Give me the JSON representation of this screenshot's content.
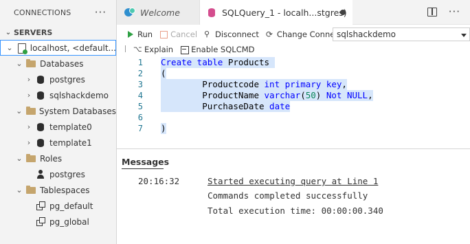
{
  "sidebar": {
    "title": "CONNECTIONS",
    "more_label": "···",
    "servers_header": "SERVERS",
    "tree": [
      {
        "label": "localhost, <default...",
        "chevron": "⌄",
        "icon": "server-icon"
      },
      {
        "label": "Databases",
        "chevron": "⌄",
        "icon": "folder-icon"
      },
      {
        "label": "postgres",
        "chevron": "›",
        "icon": "database-icon"
      },
      {
        "label": "sqlshackdemo",
        "chevron": "›",
        "icon": "database-icon"
      },
      {
        "label": "System Databases",
        "chevron": "⌄",
        "icon": "folder-icon"
      },
      {
        "label": "template0",
        "chevron": "›",
        "icon": "database-icon"
      },
      {
        "label": "template1",
        "chevron": "›",
        "icon": "database-icon"
      },
      {
        "label": "Roles",
        "chevron": "⌄",
        "icon": "folder-icon"
      },
      {
        "label": "postgres",
        "chevron": "",
        "icon": "user-icon"
      },
      {
        "label": "Tablespaces",
        "chevron": "⌄",
        "icon": "folder-icon"
      },
      {
        "label": "pg_default",
        "chevron": "",
        "icon": "tablespace-icon"
      },
      {
        "label": "pg_global",
        "chevron": "",
        "icon": "tablespace-icon"
      }
    ]
  },
  "tabs": [
    {
      "label": "Welcome",
      "icon": "welcome-icon"
    },
    {
      "label": "SQLQuery_1 - localh...stgres)",
      "icon": "database-icon",
      "dirty": true
    }
  ],
  "tab_actions": {
    "more_label": "···"
  },
  "toolbar": {
    "run": "Run",
    "cancel": "Cancel",
    "disconnect": "Disconnect",
    "change_connection": "Change Connection",
    "database": "sqlshackdemo",
    "explain": "Explain",
    "enable_sqlcmd": "Enable SQLCMD"
  },
  "editor": {
    "lines": [
      {
        "n": "1",
        "tokens": [
          {
            "t": "Create table ",
            "c": "kw"
          },
          {
            "t": "Products ",
            "c": "plain"
          }
        ]
      },
      {
        "n": "2",
        "tokens": [
          {
            "t": "(",
            "c": "plain"
          }
        ]
      },
      {
        "n": "3",
        "tokens": [
          {
            "t": "        Productcode ",
            "c": "plain"
          },
          {
            "t": "int primary key",
            "c": "kw"
          },
          {
            "t": ",",
            "c": "plain"
          }
        ]
      },
      {
        "n": "4",
        "tokens": [
          {
            "t": "        ProductName ",
            "c": "plain"
          },
          {
            "t": "varchar",
            "c": "kw"
          },
          {
            "t": "(",
            "c": "plain"
          },
          {
            "t": "50",
            "c": "num"
          },
          {
            "t": ") ",
            "c": "plain"
          },
          {
            "t": "Not NULL",
            "c": "kw"
          },
          {
            "t": ",",
            "c": "plain"
          }
        ]
      },
      {
        "n": "5",
        "tokens": [
          {
            "t": "        PurchaseDate ",
            "c": "plain"
          },
          {
            "t": "date",
            "c": "kw"
          }
        ]
      },
      {
        "n": "6",
        "tokens": [
          {
            "t": "",
            "c": "plain"
          }
        ]
      },
      {
        "n": "7",
        "tokens": [
          {
            "t": ")",
            "c": "plain"
          }
        ]
      }
    ]
  },
  "messages": {
    "title": "Messages",
    "time": "20:16:32",
    "lines": [
      "Started executing query at Line 1",
      "Commands completed successfully",
      "Total execution time: 00:00:00.340"
    ]
  }
}
